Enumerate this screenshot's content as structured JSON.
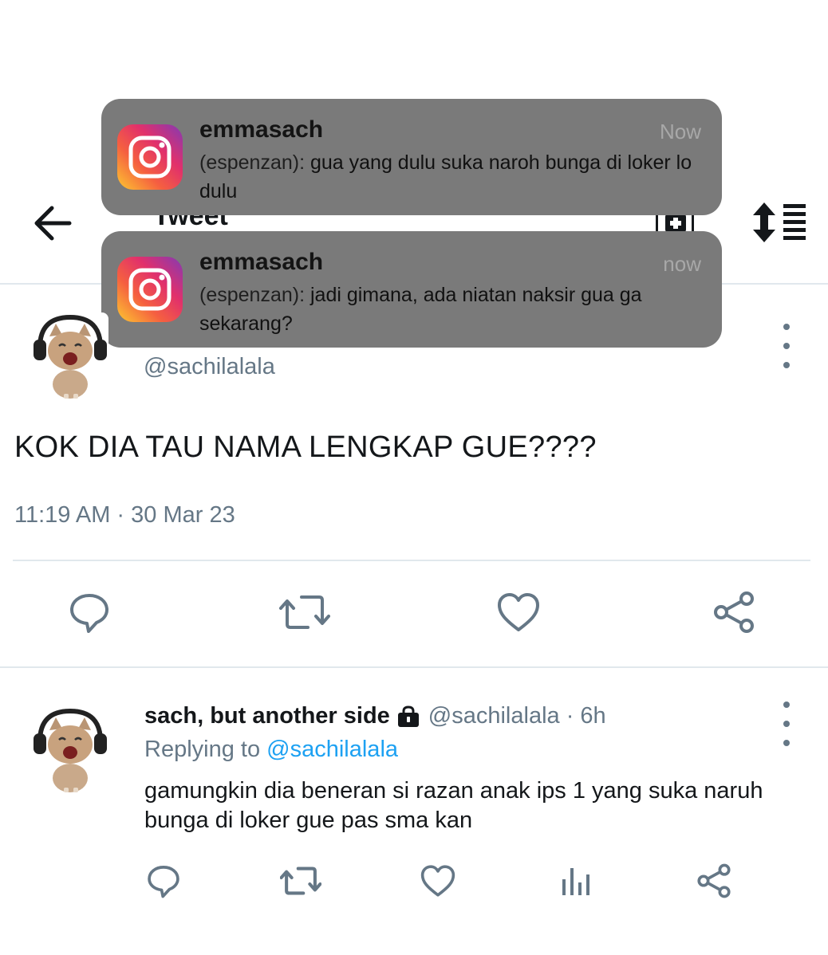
{
  "header": {
    "title": "Tweet",
    "back_icon": "arrow-left-icon",
    "sort_icon": "sort-icon"
  },
  "notifications": [
    {
      "app_icon": "instagram-icon",
      "sender": "emmasach",
      "time": "Now",
      "from": "(espenzan):",
      "message": "gua yang dulu suka naroh bunga di loker lo dulu"
    },
    {
      "app_icon": "instagram-icon",
      "sender": "emmasach",
      "time": "now",
      "from": "(espenzan):",
      "message": "jadi gimana, ada niatan naksir gua ga sekarang?"
    }
  ],
  "tweet": {
    "handle": "@sachilalala",
    "text": "KOK DIA TAU NAMA LENGKAP GUE????",
    "timestamp": "11:19 AM · 30 Mar 23",
    "actions": [
      "reply-icon",
      "retweet-icon",
      "like-icon",
      "share-icon"
    ]
  },
  "reply": {
    "name": "sach, but another side",
    "handle_time": "@sachilalala · 6h",
    "replying_prefix": "Replying to",
    "replying_to": "@sachilalala",
    "text": "gamungkin dia beneran si razan anak ips 1 yang suka naruh bunga di loker gue pas sma kan",
    "actions": [
      "reply-icon",
      "retweet-icon",
      "like-icon",
      "analytics-icon",
      "share-icon"
    ]
  },
  "colors": {
    "accent": "#1da1f2",
    "muted": "#657786",
    "notification_bg": "#7a7a7a"
  }
}
